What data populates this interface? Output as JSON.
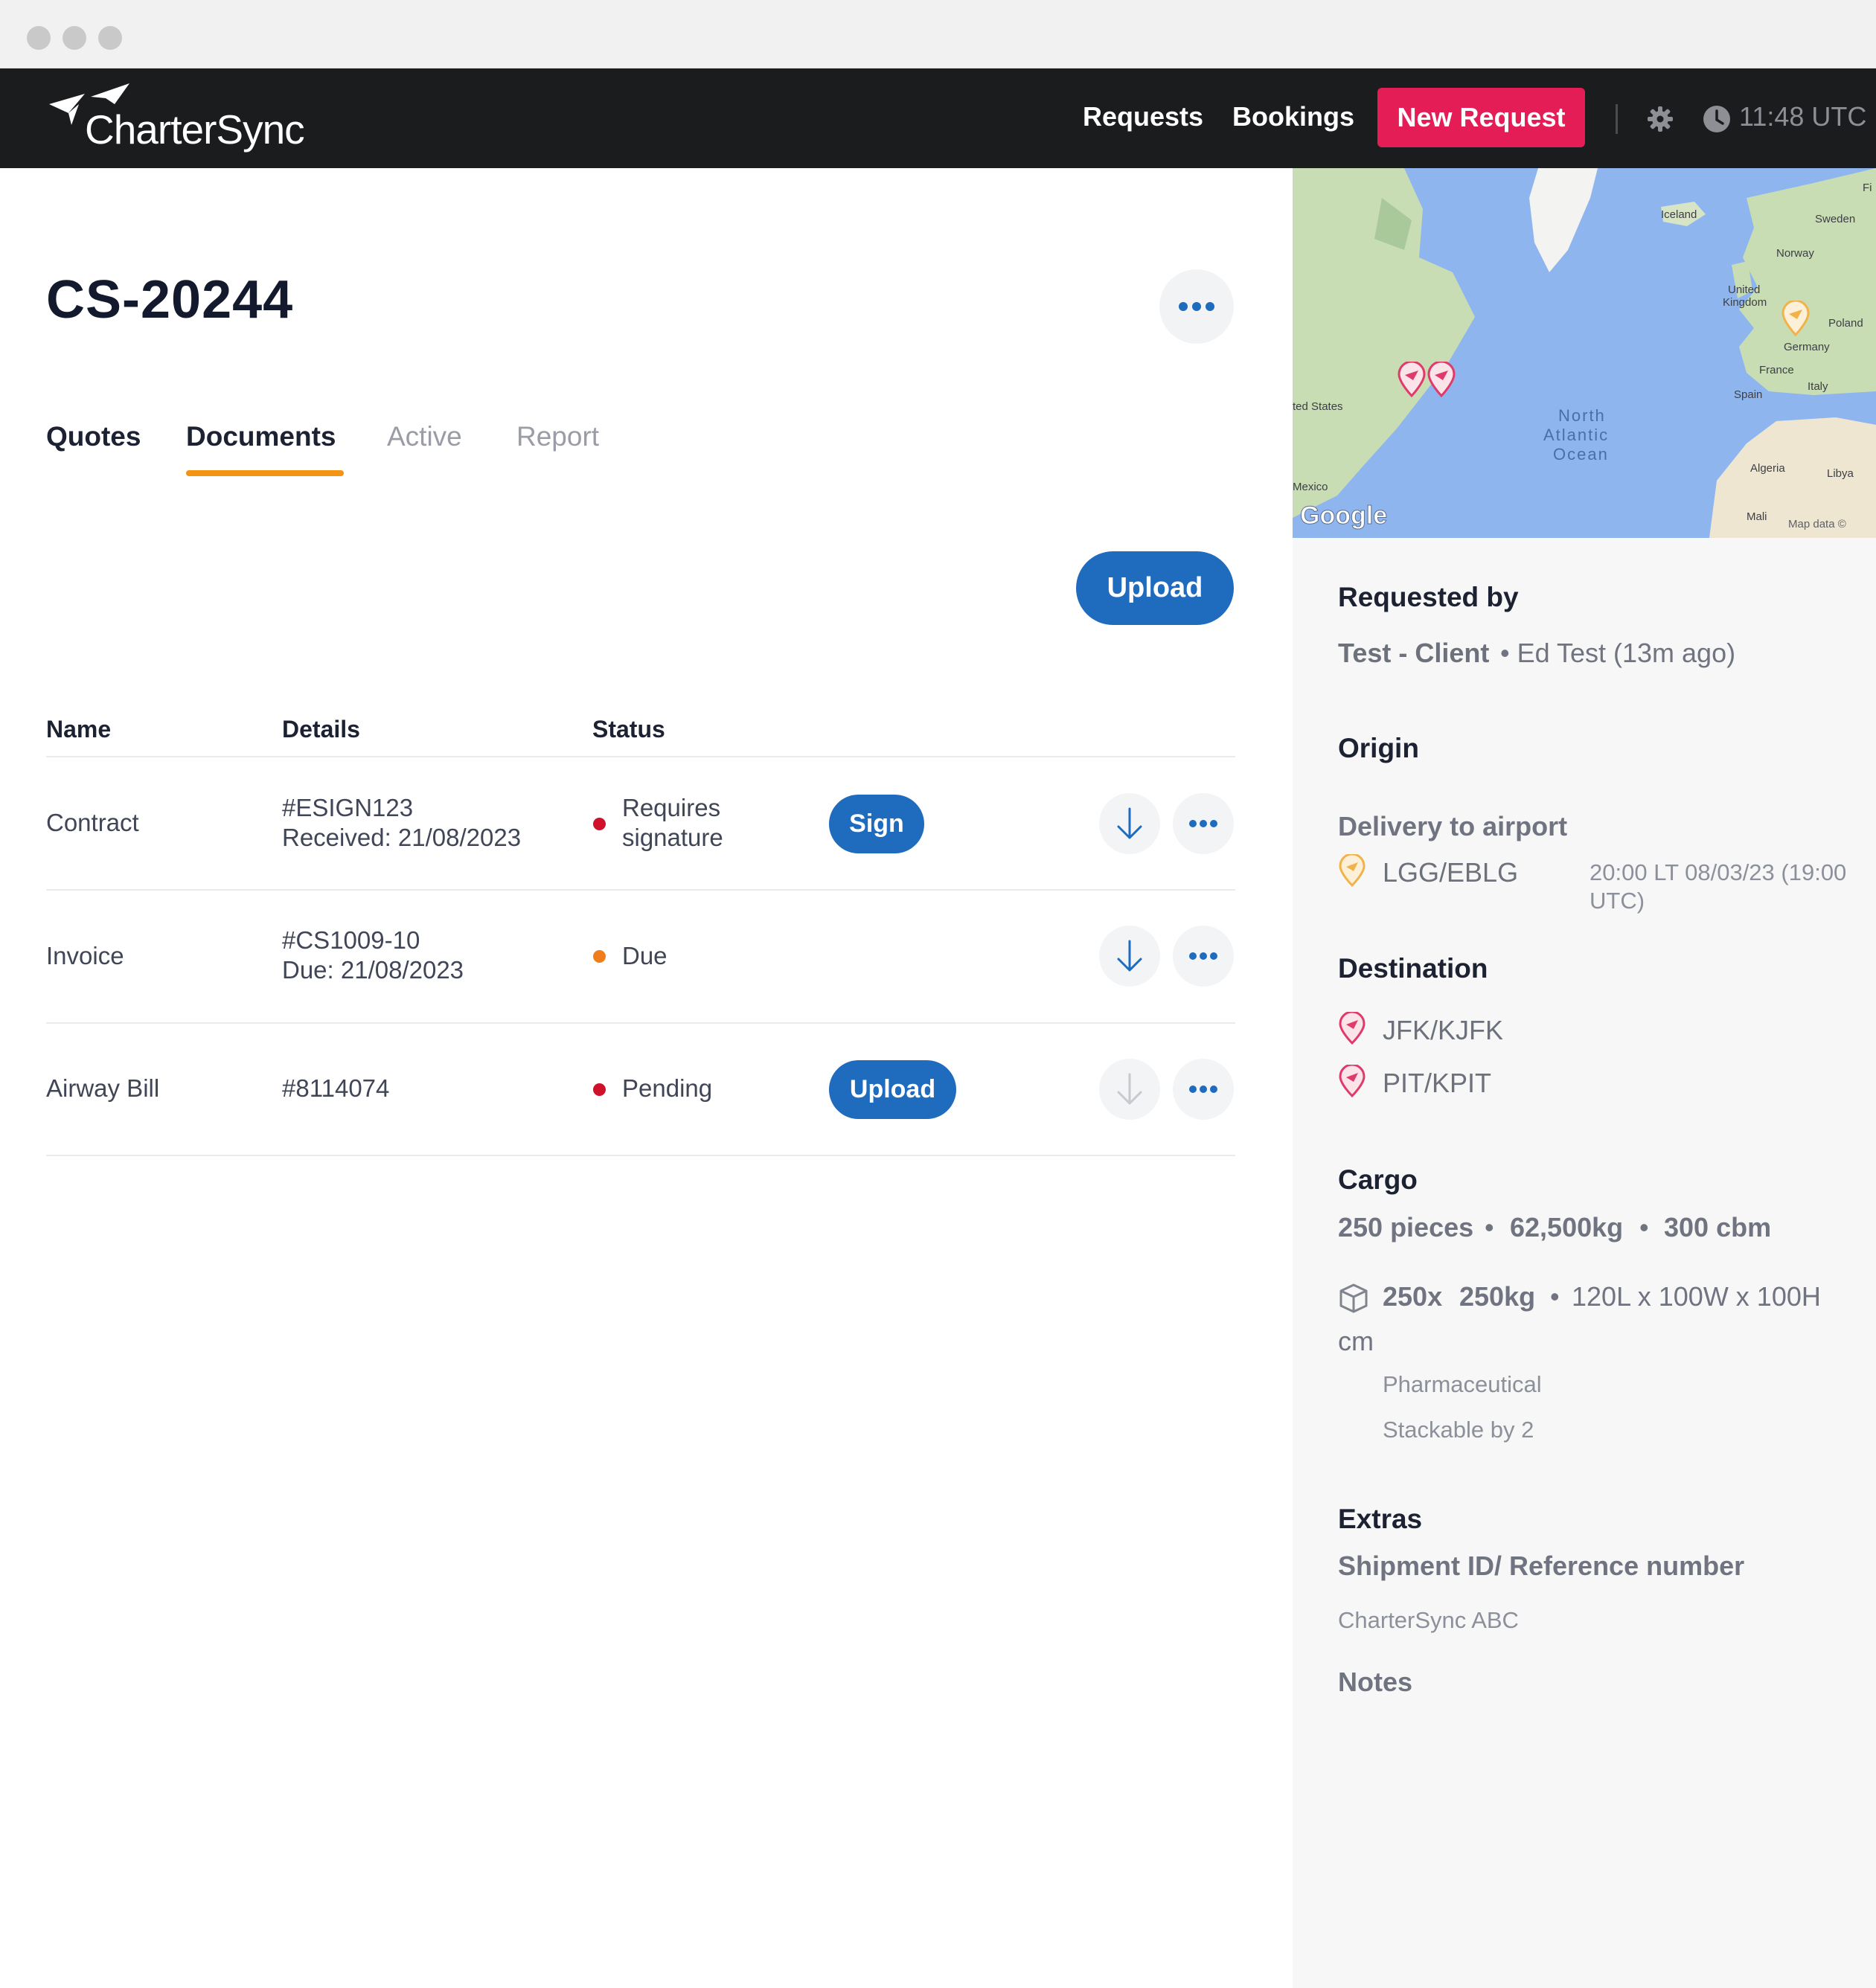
{
  "app": {
    "logo_text": "CharterSync",
    "nav": {
      "requests": "Requests",
      "bookings": "Bookings",
      "new_request": "New Request",
      "time": "11:48 UTC"
    },
    "icons": {
      "logo": "paper-plane-logo-icon",
      "settings": "gear-icon",
      "clock": "clock-icon"
    }
  },
  "page": {
    "title": "CS-20244",
    "tabs": [
      {
        "label": "Quotes",
        "active": false
      },
      {
        "label": "Documents",
        "active": true
      },
      {
        "label": "Active",
        "active": false
      },
      {
        "label": "Report",
        "active": false
      }
    ],
    "upload_label": "Upload"
  },
  "documents": {
    "columns": {
      "name": "Name",
      "details": "Details",
      "status": "Status"
    },
    "rows": [
      {
        "name": "Contract",
        "details1": "#ESIGN123",
        "details2": "Received: 21/08/2023",
        "status1": "Requires",
        "status2": "signature",
        "status_color": "#d0112b",
        "action": "Sign"
      },
      {
        "name": "Invoice",
        "details1": "#CS1009-10",
        "details2": "Due: 21/08/2023",
        "status1": "Due",
        "status_color": "#f07d1a"
      },
      {
        "name": "Airway Bill",
        "details1": "#8114074",
        "status1": "Pending",
        "status_color": "#d0112b",
        "action": "Upload"
      }
    ]
  },
  "map": {
    "brand": "Google",
    "attribution": "Map data ©",
    "labels": [
      "Iceland",
      "Sweden",
      "Norway",
      "United",
      "Kingdom",
      "Poland",
      "Germany",
      "France",
      "Italy",
      "Spain",
      "North",
      "Atlantic",
      "Ocean",
      "ted States",
      "Mexico",
      "Algeria",
      "Libya",
      "Mali",
      "Fi"
    ]
  },
  "details": {
    "requested_by": {
      "heading": "Requested by",
      "client": "Test - Client",
      "person": " • Ed Test (13m ago)"
    },
    "origin": {
      "heading": "Origin",
      "delivery": "Delivery to airport",
      "airport": "LGG/EBLG",
      "time1": "20:00 LT 08/03/23 (19:00",
      "time2": "UTC)"
    },
    "destination": {
      "heading": "Destination",
      "airports": [
        "JFK/KJFK",
        "PIT/KPIT"
      ]
    },
    "cargo": {
      "heading": "Cargo",
      "summary_pieces": "250 pieces",
      "summary_weight": "62,500kg",
      "summary_volume": "300 cbm",
      "item_qty": "250x",
      "item_weight": "250kg",
      "item_dims": "120L x 100W x 100H",
      "item_unit": "cm",
      "type": "Pharmaceutical",
      "stack": "Stackable by 2"
    },
    "extras": {
      "heading": "Extras",
      "ref_label": "Shipment ID/ Reference number",
      "ref_value": "CharterSync ABC",
      "notes_label": "Notes"
    }
  },
  "colors": {
    "primary": "#1f6bbd",
    "accent": "#e51d56",
    "tab_indicator": "#f39414",
    "nav_bg": "#1b1c1e"
  }
}
